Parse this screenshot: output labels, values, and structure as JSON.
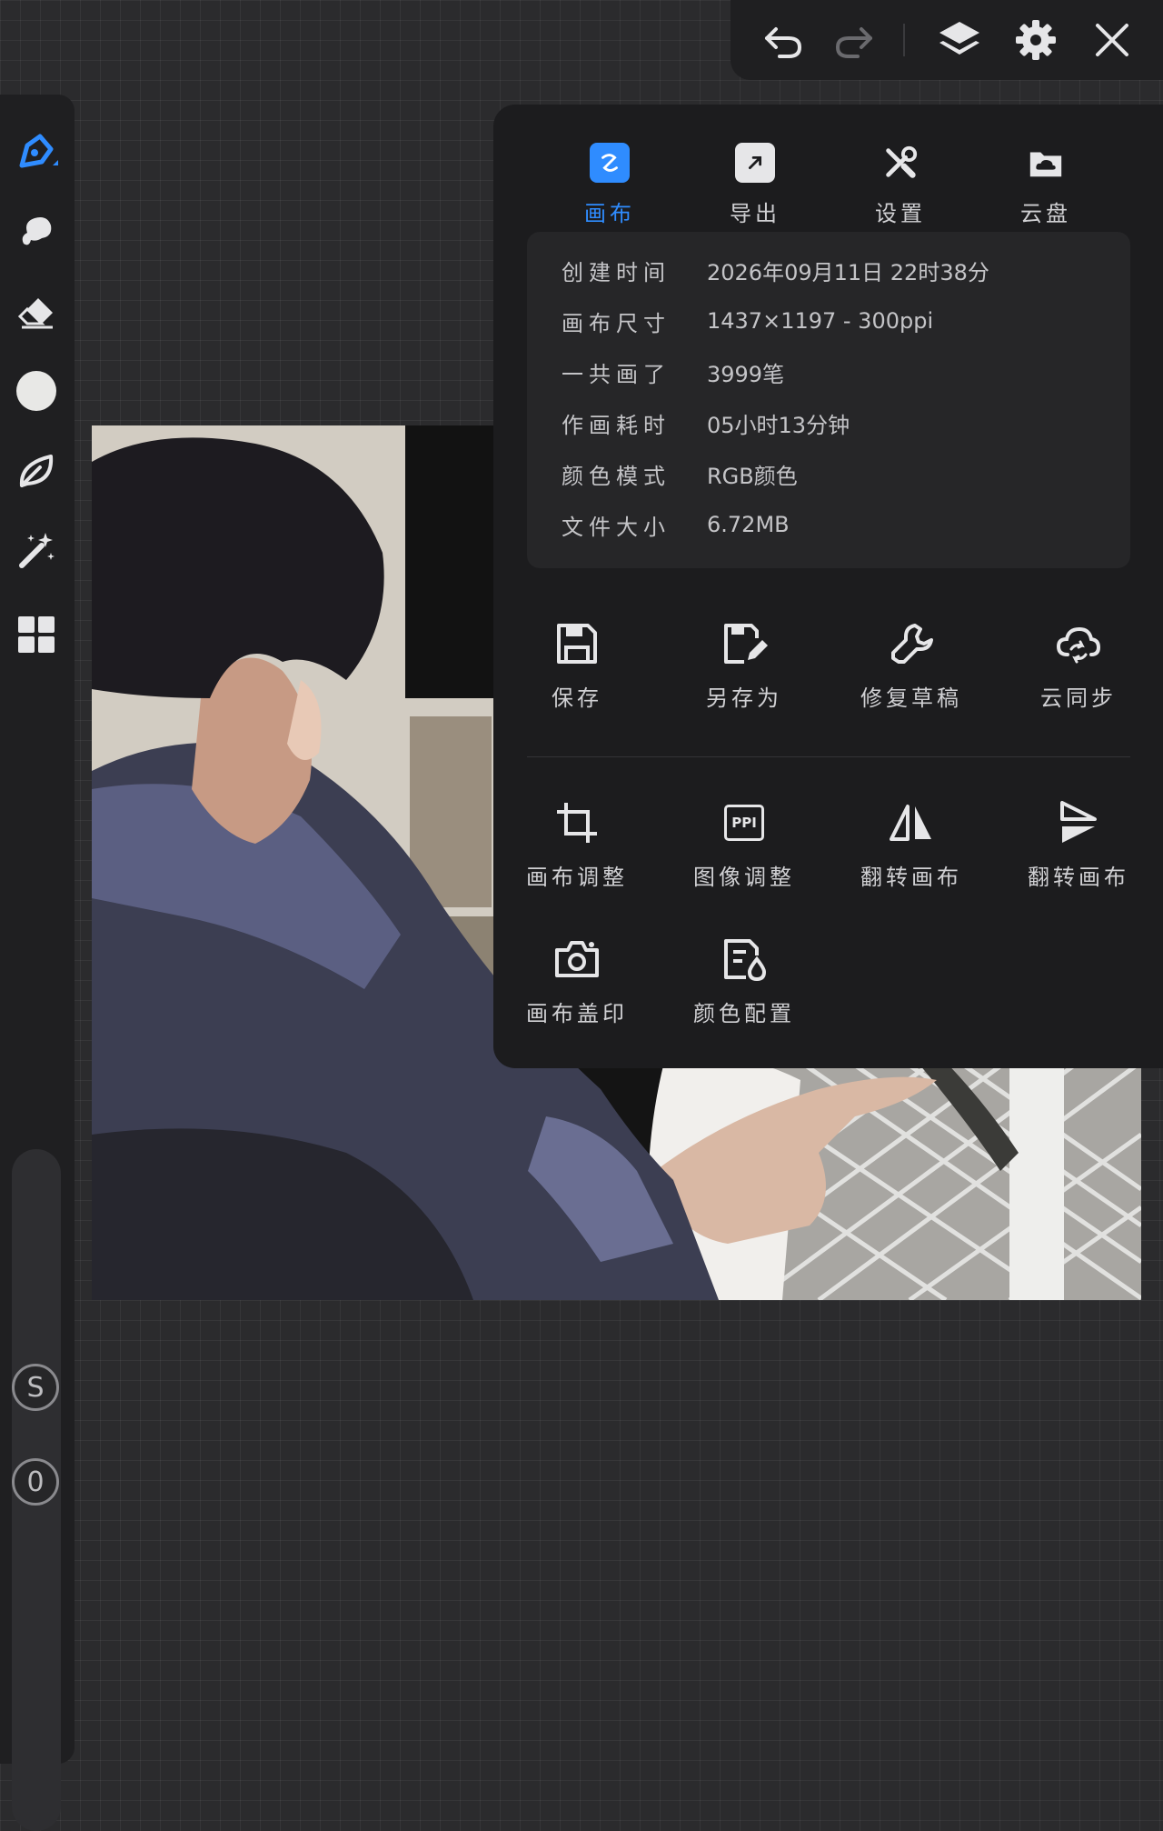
{
  "top_bar": {
    "undo_icon": "undo-icon",
    "redo_icon": "redo-icon",
    "layers_icon": "layers-icon",
    "settings_icon": "gear-icon",
    "close_icon": "close-icon"
  },
  "left_toolbar": {
    "tools": [
      "brush-icon",
      "smudge-icon",
      "eraser-icon",
      "color-circle-icon",
      "leaf-icon",
      "magic-wand-icon",
      "grid-icon"
    ],
    "size_knob_label": "S",
    "opacity_knob_label": "0",
    "accent": "#2f8cff"
  },
  "panel": {
    "tabs": [
      {
        "label": "画布",
        "icon": "canvas-tab-icon",
        "active": true
      },
      {
        "label": "导出",
        "icon": "export-icon",
        "active": false
      },
      {
        "label": "设置",
        "icon": "tools-icon",
        "active": false
      },
      {
        "label": "云盘",
        "icon": "cloud-folder-icon",
        "active": false
      }
    ],
    "info": [
      {
        "key": "创建时间",
        "value": "2026年09月11日 22时38分"
      },
      {
        "key": "画布尺寸",
        "value": "1437×1197 - 300ppi"
      },
      {
        "key": "一共画了",
        "value": "3999笔"
      },
      {
        "key": "作画耗时",
        "value": "05小时13分钟"
      },
      {
        "key": "颜色模式",
        "value": "RGB颜色"
      },
      {
        "key": "文件大小",
        "value": "6.72MB"
      }
    ],
    "actions_row1": [
      {
        "label": "保存",
        "icon": "save-icon"
      },
      {
        "label": "另存为",
        "icon": "save-as-icon"
      },
      {
        "label": "修复草稿",
        "icon": "wrench-icon"
      },
      {
        "label": "云同步",
        "icon": "cloud-sync-icon"
      }
    ],
    "actions_row2": [
      {
        "label": "画布调整",
        "icon": "crop-icon"
      },
      {
        "label": "图像调整",
        "icon": "ppi-icon",
        "icon_text": "PPI"
      },
      {
        "label": "翻转画布",
        "icon": "flip-horizontal-icon"
      },
      {
        "label": "翻转画布",
        "icon": "flip-vertical-icon"
      }
    ],
    "actions_row3": [
      {
        "label": "画布盖印",
        "icon": "camera-icon"
      },
      {
        "label": "颜色配置",
        "icon": "color-profile-icon"
      }
    ]
  }
}
